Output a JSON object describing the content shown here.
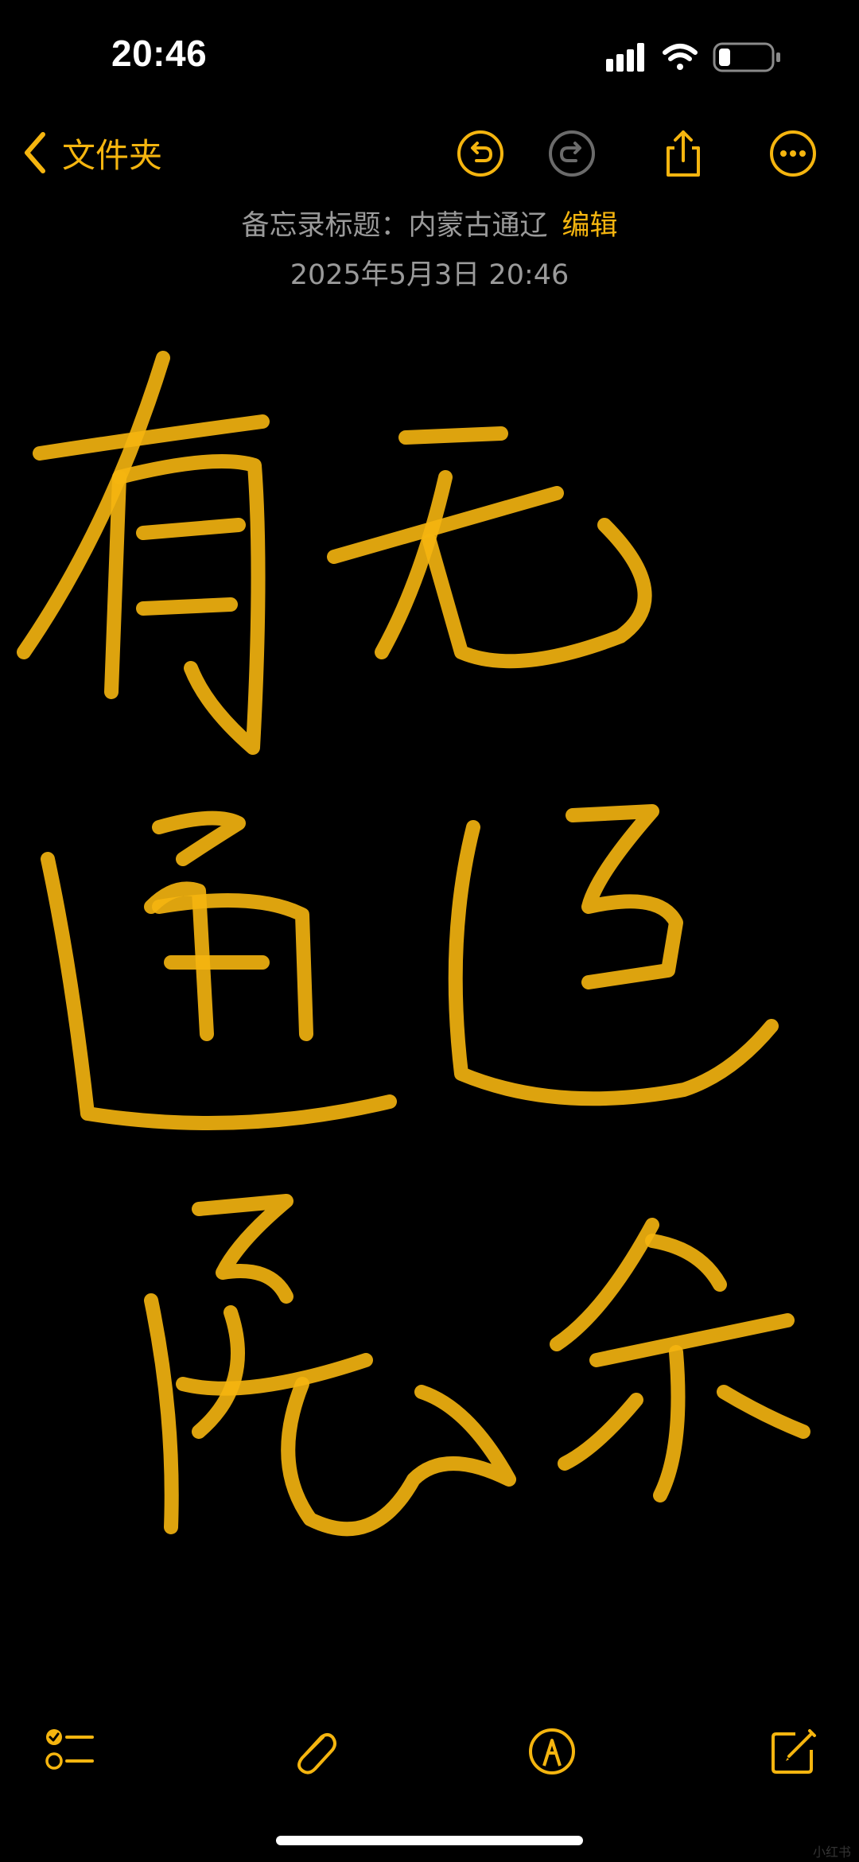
{
  "status_bar": {
    "time": "20:46",
    "icons": [
      "signal-icon",
      "wifi-icon",
      "battery-icon"
    ],
    "battery_level": 0.2
  },
  "nav": {
    "back_label": "文件夹",
    "icons": [
      "undo-icon",
      "redo-icon",
      "share-icon",
      "more-icon"
    ]
  },
  "note": {
    "title": "备忘录标题：内蒙古通辽",
    "edit_label": "编辑",
    "date": "2025年5月3日 20:46"
  },
  "drawing": {
    "ink_color": "#f5b50f",
    "description_icon": "handwriting-canvas"
  },
  "toolbar": {
    "icons": [
      "checklist-icon",
      "attachment-icon",
      "markup-pen-icon",
      "compose-icon"
    ]
  },
  "watermark": "小红书",
  "colors": {
    "accent": "#f5b50f",
    "background": "#000000",
    "muted_text": "#9a9a9a"
  }
}
